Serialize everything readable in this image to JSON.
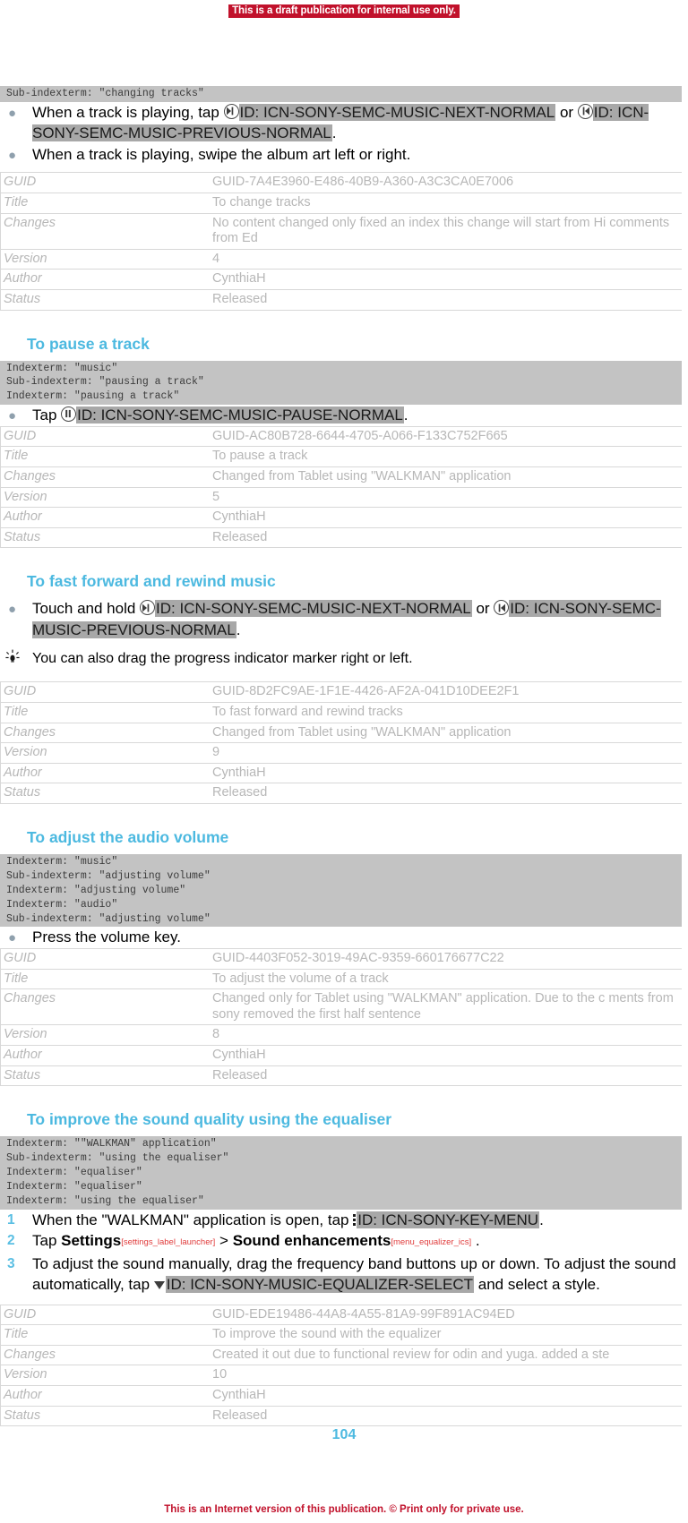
{
  "draft_banner": "This is a draft publication for internal use only.",
  "page_number": "104",
  "footer_note": "This is an Internet version of this publication. © Print only for private use.",
  "sections": [
    {
      "id": "change-tracks",
      "heading": null,
      "indexterms": "Sub-indexterm: \"changing tracks\"",
      "steps": [
        {
          "parts": [
            {
              "t": "text",
              "v": "When a track is playing, tap "
            },
            {
              "t": "icon",
              "v": "music-next-icon"
            },
            {
              "t": "id",
              "v": "ID: ICN-SONY-SEMC-MUSIC-NEXT-NORMAL"
            },
            {
              "t": "text",
              "v": " or "
            },
            {
              "t": "icon",
              "v": "music-previous-icon"
            },
            {
              "t": "id",
              "v": "ID: ICN-SONY-SEMC-MUSIC-PREVIOUS-NORMAL"
            },
            {
              "t": "text",
              "v": "."
            }
          ]
        },
        {
          "parts": [
            {
              "t": "text",
              "v": "When a track is playing, swipe the album art left or right."
            }
          ]
        }
      ],
      "meta": {
        "labels": [
          "GUID",
          "Title",
          "Changes",
          "Version",
          "Author",
          "Status"
        ],
        "values": [
          "GUID-7A4E3960-E486-40B9-A360-A3C3CA0E7006",
          "To change tracks",
          "No content changed only fixed an index this change will start from Hi comments from Ed",
          "4",
          "CynthiaH",
          "Released"
        ]
      }
    },
    {
      "id": "pause-track",
      "heading": "To pause a track",
      "indexterms": "Indexterm: \"music\"\nSub-indexterm: \"pausing a track\"\nIndexterm: \"pausing a track\"",
      "steps": [
        {
          "parts": [
            {
              "t": "text",
              "v": "Tap "
            },
            {
              "t": "icon",
              "v": "music-pause-icon"
            },
            {
              "t": "id",
              "v": "ID: ICN-SONY-SEMC-MUSIC-PAUSE-NORMAL"
            },
            {
              "t": "text",
              "v": "."
            }
          ]
        }
      ],
      "meta": {
        "labels": [
          "GUID",
          "Title",
          "Changes",
          "Version",
          "Author",
          "Status"
        ],
        "values": [
          "GUID-AC80B728-6644-4705-A066-F133C752F665",
          "To pause a track",
          "Changed from Tablet using \"WALKMAN\" application",
          "5",
          "CynthiaH",
          "Released"
        ]
      }
    },
    {
      "id": "fast-forward-rewind",
      "heading": "To fast forward and rewind music",
      "indexterms": null,
      "steps": [
        {
          "parts": [
            {
              "t": "text",
              "v": "Touch and hold "
            },
            {
              "t": "icon",
              "v": "music-next-icon"
            },
            {
              "t": "id",
              "v": "ID: ICN-SONY-SEMC-MUSIC-NEXT-NORMAL"
            },
            {
              "t": "text",
              "v": " or "
            },
            {
              "t": "icon",
              "v": "music-previous-icon"
            },
            {
              "t": "id",
              "v": "ID: ICN-SONY-SEMC-MUSIC-PREVIOUS-NORMAL"
            },
            {
              "t": "text",
              "v": "."
            }
          ]
        }
      ],
      "tip": "You can also drag the progress indicator marker right or left.",
      "meta": {
        "labels": [
          "GUID",
          "Title",
          "Changes",
          "Version",
          "Author",
          "Status"
        ],
        "values": [
          "GUID-8D2FC9AE-1F1E-4426-AF2A-041D10DEE2F1",
          "To fast forward and rewind tracks",
          "Changed from Tablet using \"WALKMAN\" application",
          "9",
          "CynthiaH",
          "Released"
        ]
      }
    },
    {
      "id": "adjust-volume",
      "heading": "To adjust the audio volume",
      "indexterms": "Indexterm: \"music\"\nSub-indexterm: \"adjusting volume\"\nIndexterm: \"adjusting volume\"\nIndexterm: \"audio\"\nSub-indexterm: \"adjusting volume\"",
      "steps": [
        {
          "parts": [
            {
              "t": "text",
              "v": "Press the volume key."
            }
          ]
        }
      ],
      "meta": {
        "labels": [
          "GUID",
          "Title",
          "Changes",
          "Version",
          "Author",
          "Status"
        ],
        "values": [
          "GUID-4403F052-3019-49AC-9359-660176677C22",
          "To adjust the volume of a track",
          "Changed only for Tablet using \"WALKMAN\" application. Due to the c ments from sony removed the first half sentence",
          "8",
          "CynthiaH",
          "Released"
        ]
      }
    },
    {
      "id": "improve-sound-equaliser",
      "heading": "To improve the sound quality using the equaliser",
      "indexterms": "Indexterm: \"\"WALKMAN\" application\"\nSub-indexterm: \"using the equaliser\"\nIndexterm: \"equaliser\"\nIndexterm: \"equaliser\"\nIndexterm: \"using the equaliser\"",
      "numbered_steps": [
        {
          "number": "1",
          "parts": [
            {
              "t": "text",
              "v": "When the \"WALKMAN\" application is open, tap "
            },
            {
              "t": "icon",
              "v": "key-menu-icon"
            },
            {
              "t": "id",
              "v": "ID: ICN-SONY-KEY-MENU"
            },
            {
              "t": "text",
              "v": "."
            }
          ]
        },
        {
          "number": "2",
          "parts": [
            {
              "t": "text",
              "v": "Tap "
            },
            {
              "t": "bold",
              "v": "Settings"
            },
            {
              "t": "ref",
              "v": "[settings_label_launcher]"
            },
            {
              "t": "text",
              "v": " > "
            },
            {
              "t": "bold",
              "v": "Sound enhancements"
            },
            {
              "t": "ref",
              "v": "[menu_equalizer_ics]"
            },
            {
              "t": "text",
              "v": " ."
            }
          ]
        },
        {
          "number": "3",
          "parts": [
            {
              "t": "text",
              "v": "To adjust the sound manually, drag the frequency band buttons up or down. To adjust the sound automatically, tap "
            },
            {
              "t": "icon",
              "v": "arrow-down-icon"
            },
            {
              "t": "id",
              "v": "ID: ICN-SONY-MUSIC-EQUALIZER-SELECT"
            },
            {
              "t": "text",
              "v": " and select a style."
            }
          ]
        }
      ],
      "meta": {
        "labels": [
          "GUID",
          "Title",
          "Changes",
          "Version",
          "Author",
          "Status"
        ],
        "values": [
          "GUID-EDE19486-44A8-4A55-81A9-99F891AC94ED",
          "To improve the sound with the equalizer",
          "Created it out due to functional review for odin and yuga. added a ste",
          "10",
          "CynthiaH",
          "Released"
        ]
      }
    }
  ],
  "colors": {
    "draft_red": "#c1112b",
    "heading_blue": "#4cb9e0",
    "id_highlight": "#a8a8a8",
    "indexterm_bg": "#c3c3c3",
    "meta_text": "#b7b7b7"
  }
}
